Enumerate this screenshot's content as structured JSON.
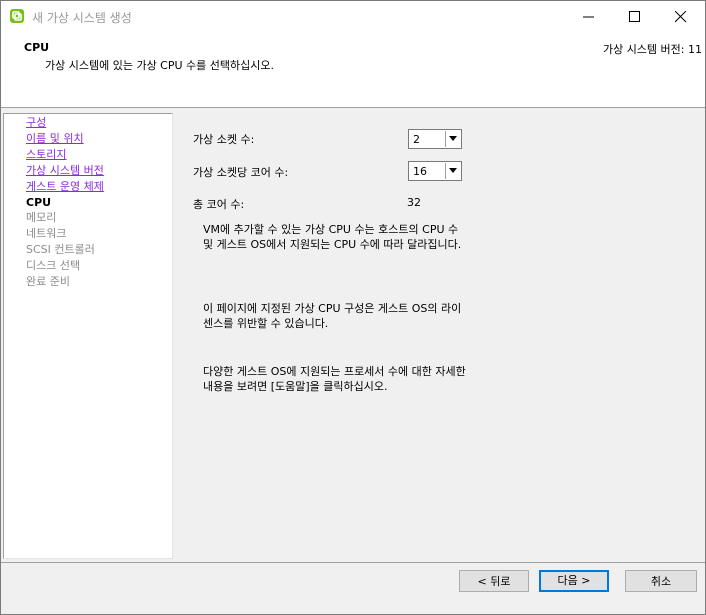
{
  "window": {
    "title": "새 가상 시스템 생성"
  },
  "header": {
    "title": "CPU",
    "description": "가상 시스템에 있는 가상 CPU 수를 선택하십시오.",
    "version": "가상 시스템 버전: 11"
  },
  "nav": {
    "items": [
      {
        "label": "구성",
        "state": "link"
      },
      {
        "label": "이름 및 위치",
        "state": "link"
      },
      {
        "label": "스토리지",
        "state": "link"
      },
      {
        "label": "가상 시스템 버전",
        "state": "link"
      },
      {
        "label": "게스트 운영 체제",
        "state": "link"
      },
      {
        "label": "CPU",
        "state": "current"
      },
      {
        "label": "메모리",
        "state": "disabled"
      },
      {
        "label": "네트워크",
        "state": "disabled"
      },
      {
        "label": "SCSI 컨트롤러",
        "state": "disabled"
      },
      {
        "label": "디스크 선택",
        "state": "disabled"
      },
      {
        "label": "완료 준비",
        "state": "disabled"
      }
    ]
  },
  "form": {
    "sockets_label": "가상 소켓 수:",
    "sockets_value": "2",
    "cores_label": "가상 소켓당 코어 수:",
    "cores_value": "16",
    "total_label": "총 코어 수:",
    "total_value": "32"
  },
  "info": {
    "p1": "VM에 추가할 수 있는 가상 CPU 수는 호스트의 CPU 수 및 게스트 OS에서 지원되는 CPU 수에 따라 달라집니다.",
    "p2": "이 페이지에 지정된 가상 CPU 구성은 게스트 OS의 라이센스를 위반할 수 있습니다.",
    "p3": "다양한 게스트 OS에 지원되는 프로세서 수에 대한 자세한 내용을 보려면 [도움말]을 클릭하십시오."
  },
  "buttons": {
    "back": "< 뒤로",
    "next": "다음 >",
    "cancel": "취소"
  },
  "icons": {
    "app": "vmware-icon",
    "minimize": "minimize-icon",
    "maximize": "maximize-icon",
    "close": "close-icon",
    "dropdown": "chevron-down-icon"
  },
  "colors": {
    "link": "#8a2be2",
    "disabled": "#8c8c8c",
    "accent": "#0078d7",
    "app_icon": "#78be20"
  }
}
